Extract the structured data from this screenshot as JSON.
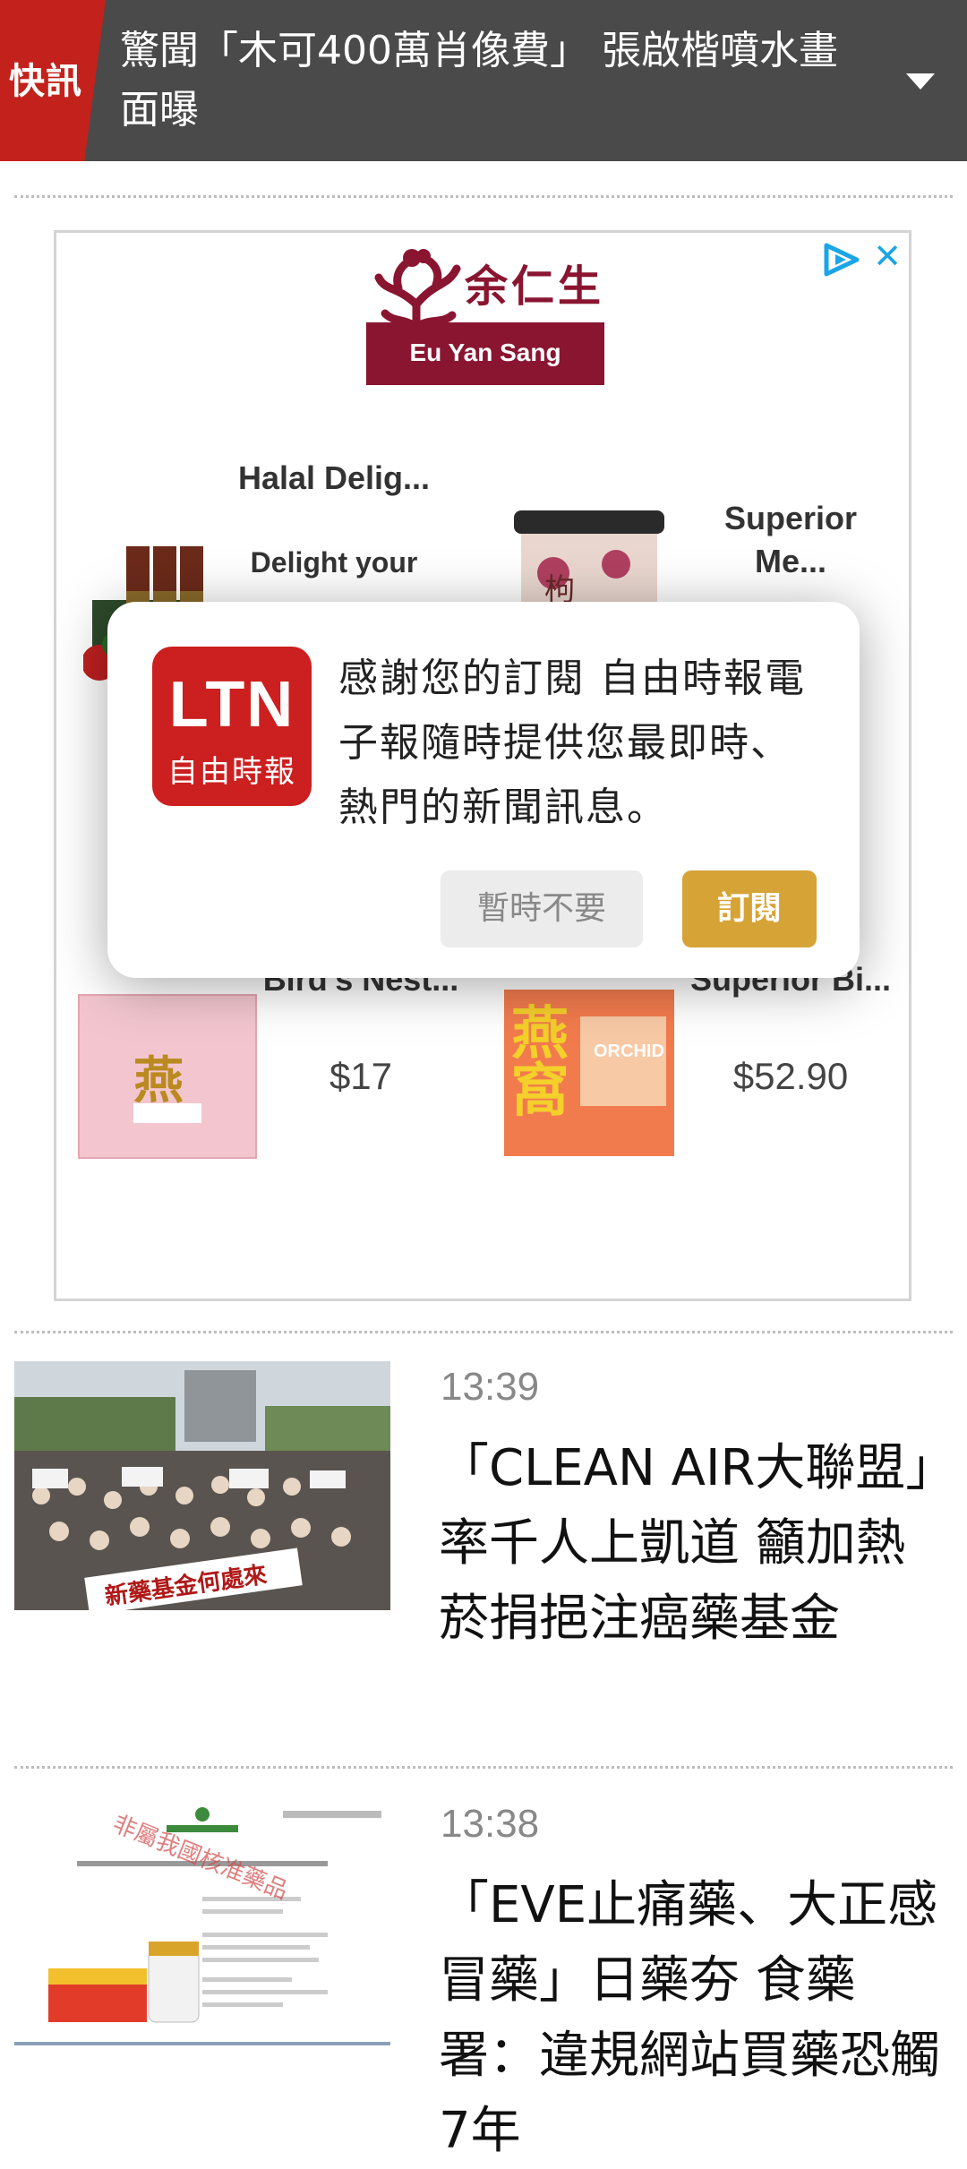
{
  "ticker": {
    "tag": "快訊",
    "headline": "驚聞「木可400萬肖像費」 張啟楷噴水畫面曝"
  },
  "ad": {
    "brand_cn": "余仁生",
    "brand_en": "Eu Yan Sang",
    "products": [
      {
        "title": "Halal Delig...",
        "subtitle": "Delight your belo..."
      },
      {
        "title": "Superior Me..."
      },
      {
        "title": "Bird's Nest...",
        "price": "$17"
      },
      {
        "title": "Superior Bi...",
        "price": "$52.90"
      }
    ],
    "pink_box_text": "燕",
    "orange_box_text": "燕窩",
    "orange_box_label": "ORCHID"
  },
  "dialog": {
    "logo_top": "LTN",
    "logo_bottom": "自由時報",
    "message": "感謝您的訂閱 自由時報電子報隨時提供您最即時、熱門的新聞訊息。",
    "later_label": "暫時不要",
    "subscribe_label": "訂閱"
  },
  "news": [
    {
      "time": "13:39",
      "title": "「CLEAN AIR大聯盟」率千人上凱道 籲加熱菸捐挹注癌藥基金",
      "banner": "新藥基金何處來"
    },
    {
      "time": "13:38",
      "title": "「EVE止痛藥、大正感冒藥」日藥夯 食藥署：違規網站買藥恐觸7年",
      "watermark": "非屬我國核准藥品"
    }
  ],
  "colors": {
    "ticker_bg": "#4a4a4a",
    "tag_red": "#c2221b",
    "brand": "#8a1531",
    "subscribe": "#d6a336",
    "ltn_red": "#cc1f1f"
  }
}
